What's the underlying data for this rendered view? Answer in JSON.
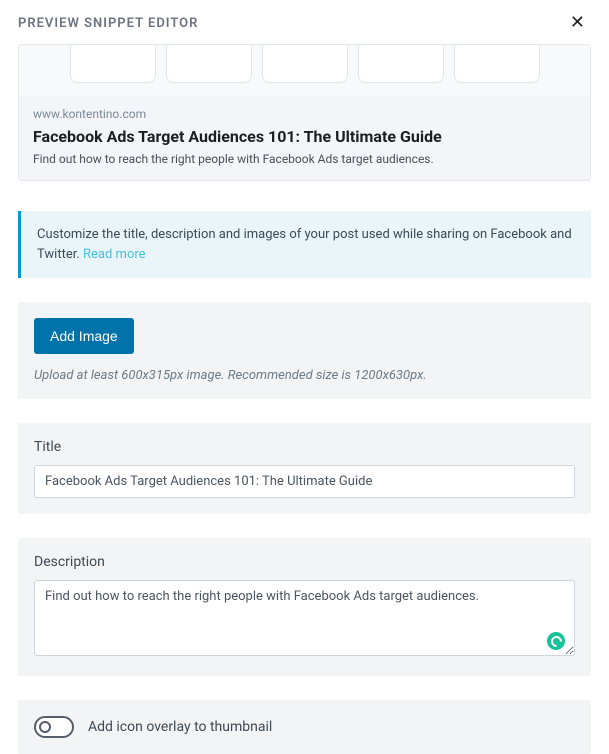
{
  "header": {
    "title": "PREVIEW SNIPPET EDITOR"
  },
  "preview": {
    "domain": "www.kontentino.com",
    "title": "Facebook Ads Target Audiences 101: The Ultimate Guide",
    "description": "Find out how to reach the right people with Facebook Ads target audiences."
  },
  "info": {
    "text": "Customize the title, description and images of your post used while sharing on Facebook and Twitter. ",
    "read_more": "Read more"
  },
  "image_section": {
    "button": "Add Image",
    "hint": "Upload at least 600x315px image. Recommended size is 1200x630px."
  },
  "title_section": {
    "label": "Title",
    "value": "Facebook Ads Target Audiences 101: The Ultimate Guide"
  },
  "description_section": {
    "label": "Description",
    "value": "Find out how to reach the right people with Facebook Ads target audiences."
  },
  "overlay_section": {
    "label": "Add icon overlay to thumbnail",
    "enabled": false
  }
}
